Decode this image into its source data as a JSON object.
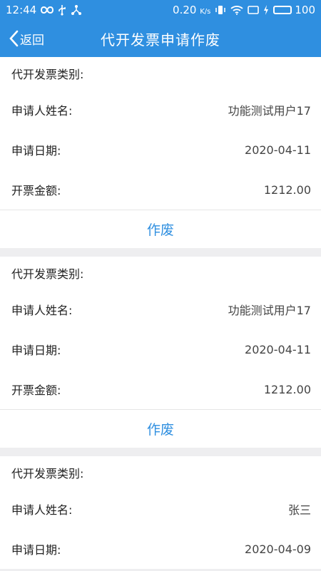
{
  "status": {
    "time": "12:44",
    "speed": "0.20",
    "speed_unit": "K/s",
    "battery": "100"
  },
  "nav": {
    "back_label": "返回",
    "title": "代开发票申请作废"
  },
  "labels": {
    "category": "代开发票类别:",
    "name": "申请人姓名:",
    "date": "申请日期:",
    "amount": "开票金额:",
    "void_button": "作废"
  },
  "records": [
    {
      "category": "",
      "name": "功能测试用户17",
      "date": "2020-04-11",
      "amount": "1212.00"
    },
    {
      "category": "",
      "name": "功能测试用户17",
      "date": "2020-04-11",
      "amount": "1212.00"
    },
    {
      "category": "",
      "name": "张三",
      "date": "2020-04-09"
    }
  ]
}
